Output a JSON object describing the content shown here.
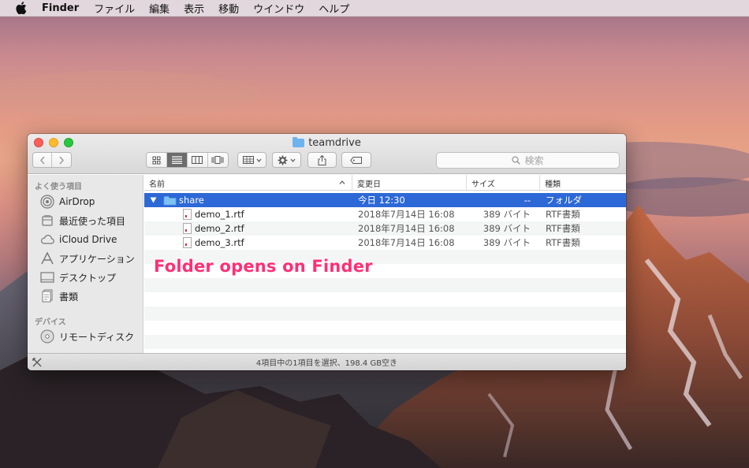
{
  "menubar": {
    "apple_icon": "apple-icon",
    "app_name": "Finder",
    "items": [
      "ファイル",
      "編集",
      "表示",
      "移動",
      "ウインドウ",
      "ヘルプ"
    ]
  },
  "window": {
    "title": "teamdrive",
    "search_placeholder": "検索"
  },
  "sidebar": {
    "favorites_heading": "よく使う項目",
    "favorites": [
      {
        "label": "AirDrop",
        "icon": "airdrop-icon"
      },
      {
        "label": "最近使った項目",
        "icon": "recents-icon"
      },
      {
        "label": "iCloud Drive",
        "icon": "icloud-icon"
      },
      {
        "label": "アプリケーション",
        "icon": "applications-icon"
      },
      {
        "label": "デスクトップ",
        "icon": "desktop-icon"
      },
      {
        "label": "書類",
        "icon": "documents-icon"
      }
    ],
    "devices_heading": "デバイス",
    "devices": [
      {
        "label": "リモートディスク",
        "icon": "remote-disc-icon"
      }
    ]
  },
  "list": {
    "columns": [
      "名前",
      "変更日",
      "サイズ",
      "種類"
    ],
    "rows": [
      {
        "name": "share",
        "date": "今日 12:30",
        "size": "--",
        "kind": "フォルダ"
      },
      {
        "name": "demo_1.rtf",
        "date": "2018年7月14日 16:08",
        "size": "389 バイト",
        "kind": "RTF書類"
      },
      {
        "name": "demo_2.rtf",
        "date": "2018年7月14日 16:08",
        "size": "389 バイト",
        "kind": "RTF書類"
      },
      {
        "name": "demo_3.rtf",
        "date": "2018年7月14日 16:08",
        "size": "389 バイト",
        "kind": "RTF書類"
      }
    ]
  },
  "status": {
    "text": "4項目中の1項目を選択、198.4 GB空き"
  },
  "overlay": {
    "caption": "Folder opens on Finder"
  },
  "colors": {
    "selection": "#2d68d7",
    "caption": "#ff2f76",
    "folder": "#6db3ee"
  }
}
